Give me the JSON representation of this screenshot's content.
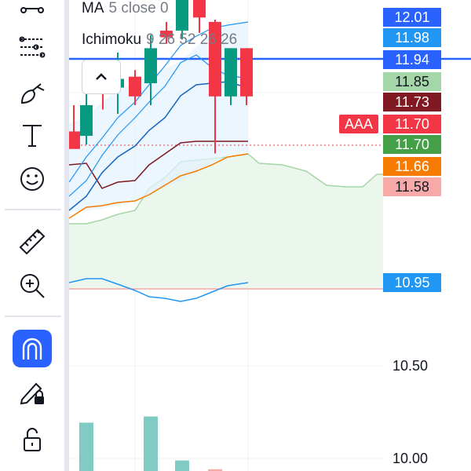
{
  "legend": {
    "ma_name": "MA",
    "ma_params": "5 close 0",
    "ichimoku_name": "Ichimoku",
    "ichimoku_params": "9 26 52 26 26"
  },
  "symbol_tag": "AAA",
  "price_tags": [
    {
      "label": "12.01",
      "bg": "#2962ff"
    },
    {
      "label": "11.98",
      "bg": "#2196f3"
    },
    {
      "label": "11.94",
      "bg": "#2962ff"
    },
    {
      "label": "11.85",
      "bg": "#a5d6a7",
      "fg": "#131722"
    },
    {
      "label": "11.73",
      "bg": "#801922"
    },
    {
      "label": "11.70",
      "bg": "#f23645"
    },
    {
      "label": "11.70",
      "bg": "#43a047"
    },
    {
      "label": "11.66",
      "bg": "#f57c00"
    },
    {
      "label": "11.58",
      "bg": "#f7a9a8",
      "fg": "#131722"
    },
    {
      "label": "10.95",
      "bg": "#2196f3"
    }
  ],
  "axis_labels": [
    "10.50",
    "10.00"
  ],
  "chart_data": {
    "type": "candlestick",
    "ylim": [
      9.95,
      12.1
    ],
    "candles": [
      {
        "o": 11.5,
        "h": 11.62,
        "l": 11.45,
        "c": 11.42,
        "dir": "down"
      },
      {
        "o": 11.48,
        "h": 11.68,
        "l": 11.44,
        "c": 11.62,
        "dir": "up"
      },
      {
        "o": 11.72,
        "h": 11.8,
        "l": 11.6,
        "c": 11.7,
        "dir": "down"
      },
      {
        "o": 11.7,
        "h": 11.86,
        "l": 11.58,
        "c": 11.74,
        "dir": "up"
      },
      {
        "o": 11.75,
        "h": 11.78,
        "l": 11.62,
        "c": 11.66,
        "dir": "down"
      },
      {
        "o": 11.72,
        "h": 11.94,
        "l": 11.62,
        "c": 11.88,
        "dir": "up"
      },
      {
        "o": 11.96,
        "h": 12.0,
        "l": 11.9,
        "c": 11.93,
        "dir": "down"
      },
      {
        "o": 11.96,
        "h": 12.16,
        "l": 11.92,
        "c": 12.1,
        "dir": "up"
      },
      {
        "o": 12.1,
        "h": 12.2,
        "l": 11.95,
        "c": 12.02,
        "dir": "down"
      },
      {
        "o": 12.0,
        "h": 12.01,
        "l": 11.4,
        "c": 11.66,
        "dir": "down"
      },
      {
        "o": 11.66,
        "h": 11.88,
        "l": 11.62,
        "c": 11.88,
        "dir": "up"
      },
      {
        "o": 11.88,
        "h": 11.88,
        "l": 11.62,
        "c": 11.66,
        "dir": "down"
      }
    ],
    "volume": [
      0,
      0.55,
      0,
      0,
      0,
      0.62,
      0,
      0.12,
      0,
      0.02,
      0,
      0
    ],
    "horizontal_line": 11.94,
    "dotted_line": 11.66,
    "red_line": 10.94
  }
}
